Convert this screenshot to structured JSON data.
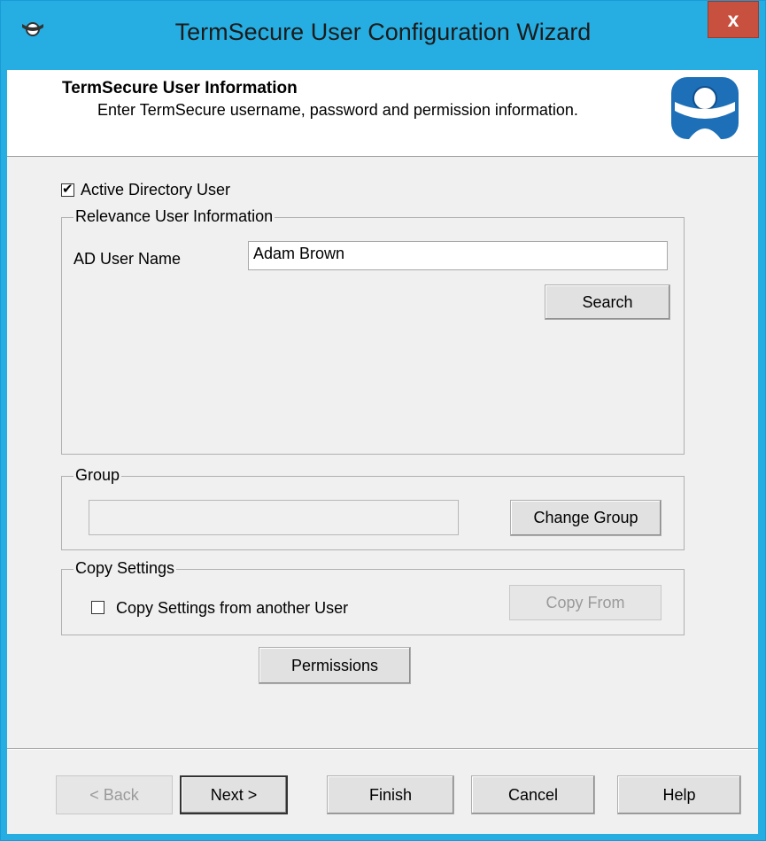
{
  "window": {
    "title": "TermSecure User Configuration Wizard",
    "close_label": "x"
  },
  "header": {
    "title": "TermSecure User Information",
    "subtitle": "Enter TermSecure username, password and permission information."
  },
  "active_directory": {
    "label": "Active Directory User",
    "checked": true
  },
  "relevance_group": {
    "legend": "Relevance User Information",
    "ad_user_label": "AD User Name",
    "ad_user_value": "Adam Brown",
    "search_label": "Search"
  },
  "group_box": {
    "legend": "Group",
    "value": "",
    "change_label": "Change Group"
  },
  "copy_settings": {
    "legend": "Copy Settings",
    "checkbox_label": "Copy Settings from another User",
    "checked": false,
    "copy_from_label": "Copy From"
  },
  "permissions_label": "Permissions",
  "footer": {
    "back_label": "< Back",
    "next_label": "Next >",
    "finish_label": "Finish",
    "cancel_label": "Cancel",
    "help_label": "Help"
  },
  "colors": {
    "titlebar": "#26aee2",
    "close": "#c7503f",
    "logo": "#1d6fb8"
  }
}
